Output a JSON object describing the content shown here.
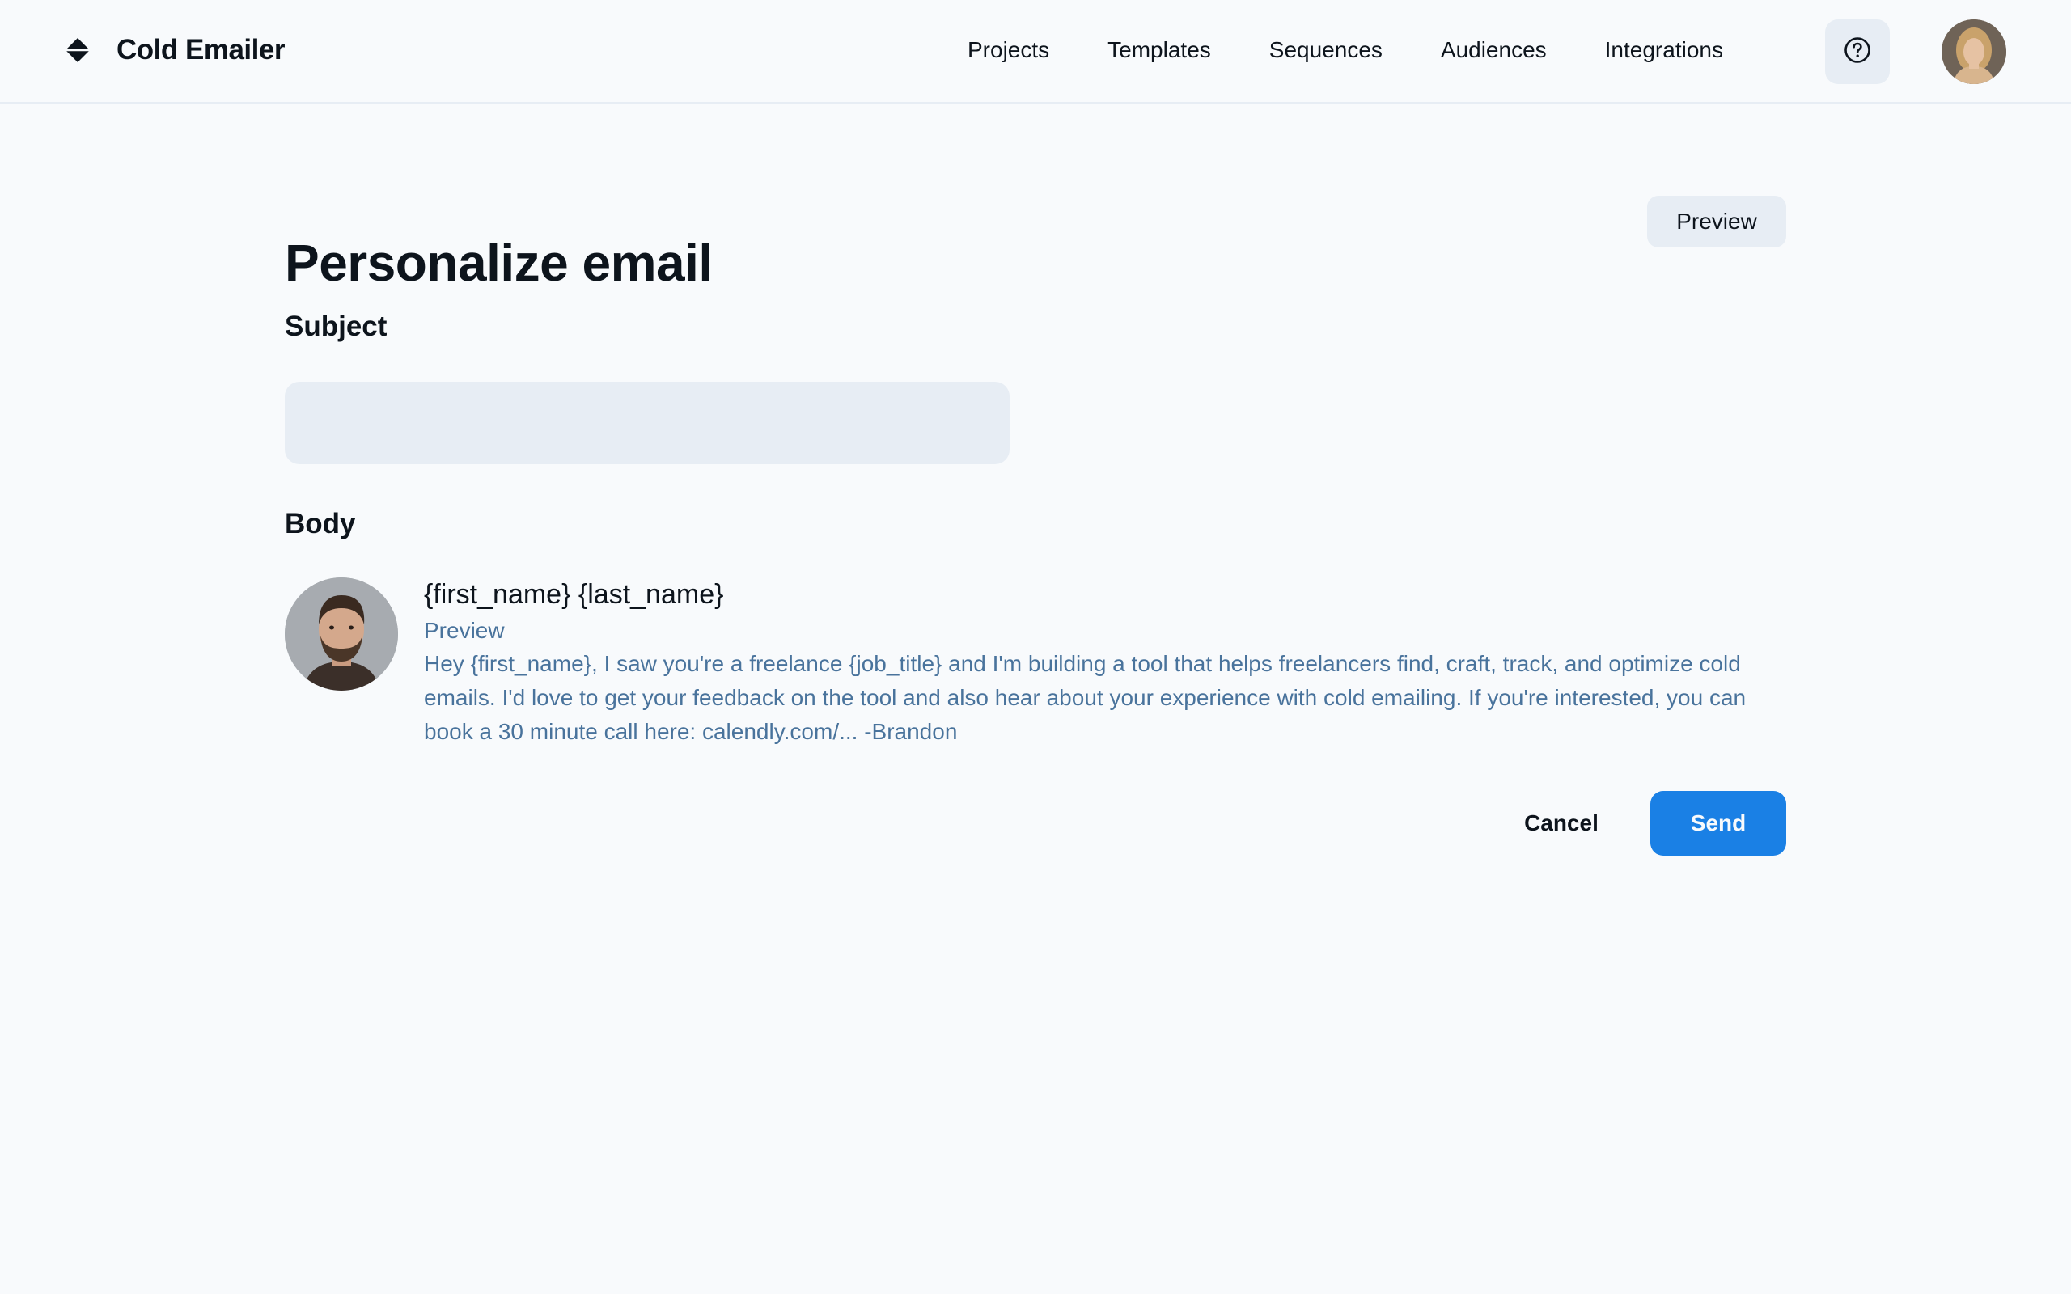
{
  "app": {
    "name": "Cold Emailer",
    "logo_icon": "diamond-logo-icon"
  },
  "nav": {
    "items": [
      {
        "label": "Projects"
      },
      {
        "label": "Templates"
      },
      {
        "label": "Sequences"
      },
      {
        "label": "Audiences"
      },
      {
        "label": "Integrations"
      }
    ],
    "help_icon": "question-circle-icon",
    "user_avatar": "user-avatar-photo"
  },
  "page": {
    "title": "Personalize email",
    "preview_button": "Preview"
  },
  "subject": {
    "label": "Subject",
    "value": "",
    "placeholder": ""
  },
  "body": {
    "label": "Body",
    "contact_avatar": "contact-avatar-photo",
    "recipient": "{first_name} {last_name}",
    "subtitle": "Preview",
    "text": "Hey {first_name}, I saw you're a freelance {job_title} and I'm building a tool that helps freelancers find, craft, track, and optimize cold emails. I'd love to get your feedback on the tool and also hear about your experience with cold emailing. If you're interested, you can book a 30 minute call here: calendly.com/... -Brandon"
  },
  "actions": {
    "cancel": "Cancel",
    "send": "Send"
  },
  "colors": {
    "background": "#f8fafc",
    "text": "#0d141c",
    "muted_text": "#49739c",
    "input_bg": "#e7edf4",
    "primary": "#1a80e5"
  }
}
